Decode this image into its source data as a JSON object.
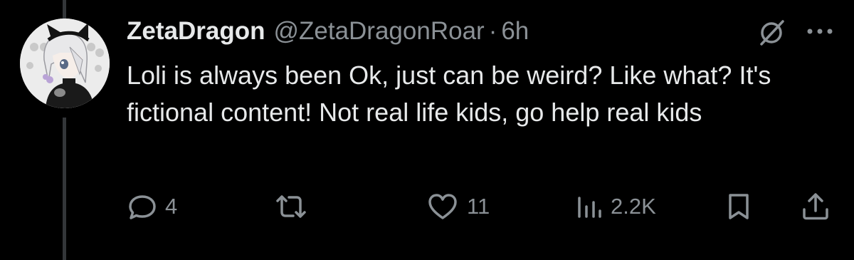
{
  "tweet": {
    "author": {
      "display_name": "ZetaDragon",
      "handle": "@ZetaDragonRoar",
      "avatar_icon": "anime-character-avatar"
    },
    "separator": "·",
    "timestamp": "6h",
    "text": "Loli is always been Ok, just can be weird? Like what? It's fictional content! Not real life kids, go help real kids",
    "actions": {
      "reply": {
        "icon": "reply-icon",
        "count": "4"
      },
      "repost": {
        "icon": "repost-icon",
        "count": ""
      },
      "like": {
        "icon": "heart-icon",
        "count": "11"
      },
      "views": {
        "icon": "views-icon",
        "count": "2.2K"
      },
      "bookmark": {
        "icon": "bookmark-icon"
      },
      "share": {
        "icon": "share-icon"
      }
    },
    "header_icons": [
      "grok-icon",
      "more-icon"
    ]
  },
  "colors": {
    "background": "#000000",
    "text_primary": "#e7e9ea",
    "text_secondary": "#8b9196",
    "thread_line": "#333639"
  }
}
